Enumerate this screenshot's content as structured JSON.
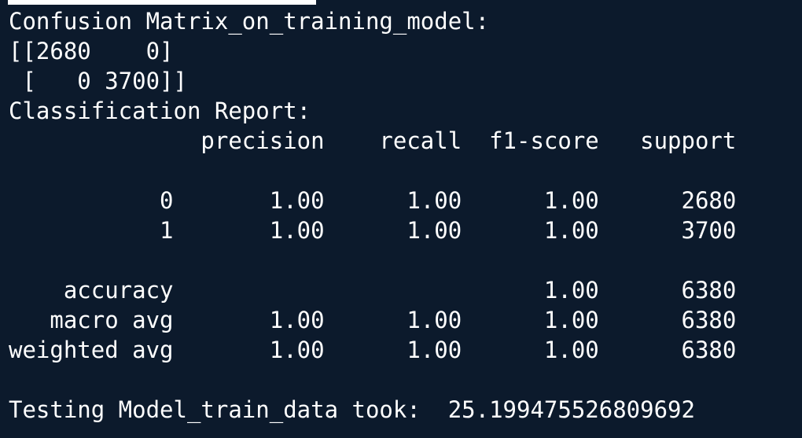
{
  "terminal": {
    "lines": [
      "Confusion Matrix_on_training_model:",
      "[[2680    0]",
      " [   0 3700]]",
      "Classification Report:",
      "              precision    recall  f1-score   support",
      "",
      "           0       1.00      1.00      1.00      2680",
      "           1       1.00      1.00      1.00      3700",
      "",
      "    accuracy                           1.00      6380",
      "   macro avg       1.00      1.00      1.00      6380",
      "weighted avg       1.00      1.00      1.00      6380",
      "",
      "Testing Model_train_data took:  25.199475526809692"
    ]
  }
}
